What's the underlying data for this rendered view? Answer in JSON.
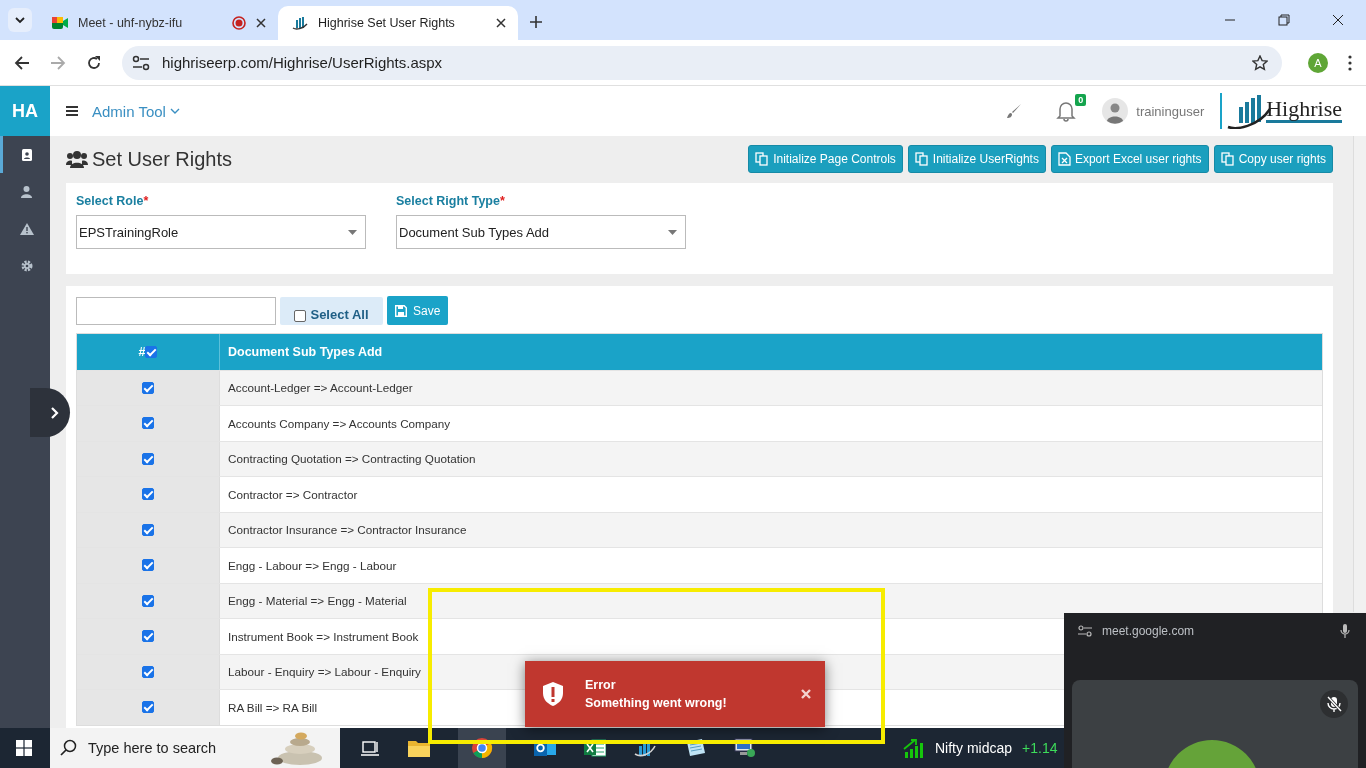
{
  "browser": {
    "tabs": [
      {
        "title": "Meet - uhf-nybz-ifu",
        "selected": false,
        "recording": true
      },
      {
        "title": "Highrise Set User Rights",
        "selected": true,
        "recording": false
      }
    ],
    "url": "highriseerp.com/Highrise/UserRights.aspx",
    "profile_initial": "A"
  },
  "app": {
    "logo": "HA",
    "menu": "Admin Tool",
    "notification_count": "0",
    "user": "traininguser",
    "brand": "Highrise"
  },
  "sidebar": {
    "items": [
      {
        "selected": true
      },
      {
        "selected": false
      },
      {
        "selected": false
      },
      {
        "selected": false
      }
    ]
  },
  "page": {
    "title": "Set User Rights",
    "actions": [
      "Initialize Page Controls",
      "Initialize UserRights",
      "Export Excel user rights",
      "Copy user rights"
    ]
  },
  "filters": [
    {
      "label": "Select Role",
      "required_mark": "*",
      "value": "EPSTrainingRole"
    },
    {
      "label": "Select Right Type",
      "required_mark": "*",
      "value": "Document Sub Types Add"
    }
  ],
  "toolbar": {
    "select_all": {
      "label": "Select All",
      "checked": false
    },
    "save": "Save"
  },
  "table": {
    "columns": [
      {
        "label": "#",
        "checked": true
      },
      {
        "label": "Document Sub Types Add"
      }
    ],
    "rows": [
      {
        "label": "Account-Ledger => Account-Ledger",
        "checked": true
      },
      {
        "label": "Accounts Company => Accounts Company",
        "checked": true
      },
      {
        "label": "Contracting Quotation => Contracting Quotation",
        "checked": true
      },
      {
        "label": "Contractor => Contractor",
        "checked": true
      },
      {
        "label": "Contractor Insurance => Contractor Insurance",
        "checked": true
      },
      {
        "label": "Engg - Labour => Engg - Labour",
        "checked": true
      },
      {
        "label": "Engg - Material => Engg - Material",
        "checked": true
      },
      {
        "label": "Instrument Book => Instrument Book",
        "checked": true
      },
      {
        "label": "Labour - Enquiry => Labour - Enquiry",
        "checked": true
      },
      {
        "label": "RA Bill => RA Bill",
        "checked": true
      }
    ]
  },
  "toast": {
    "title": "Error",
    "message": "Something went wrong!"
  },
  "meet_overlay": {
    "url": "meet.google.com"
  },
  "taskbar": {
    "search_placeholder": "Type here to search",
    "widget": {
      "name": "Nifty midcap",
      "change": "+1.14"
    }
  }
}
